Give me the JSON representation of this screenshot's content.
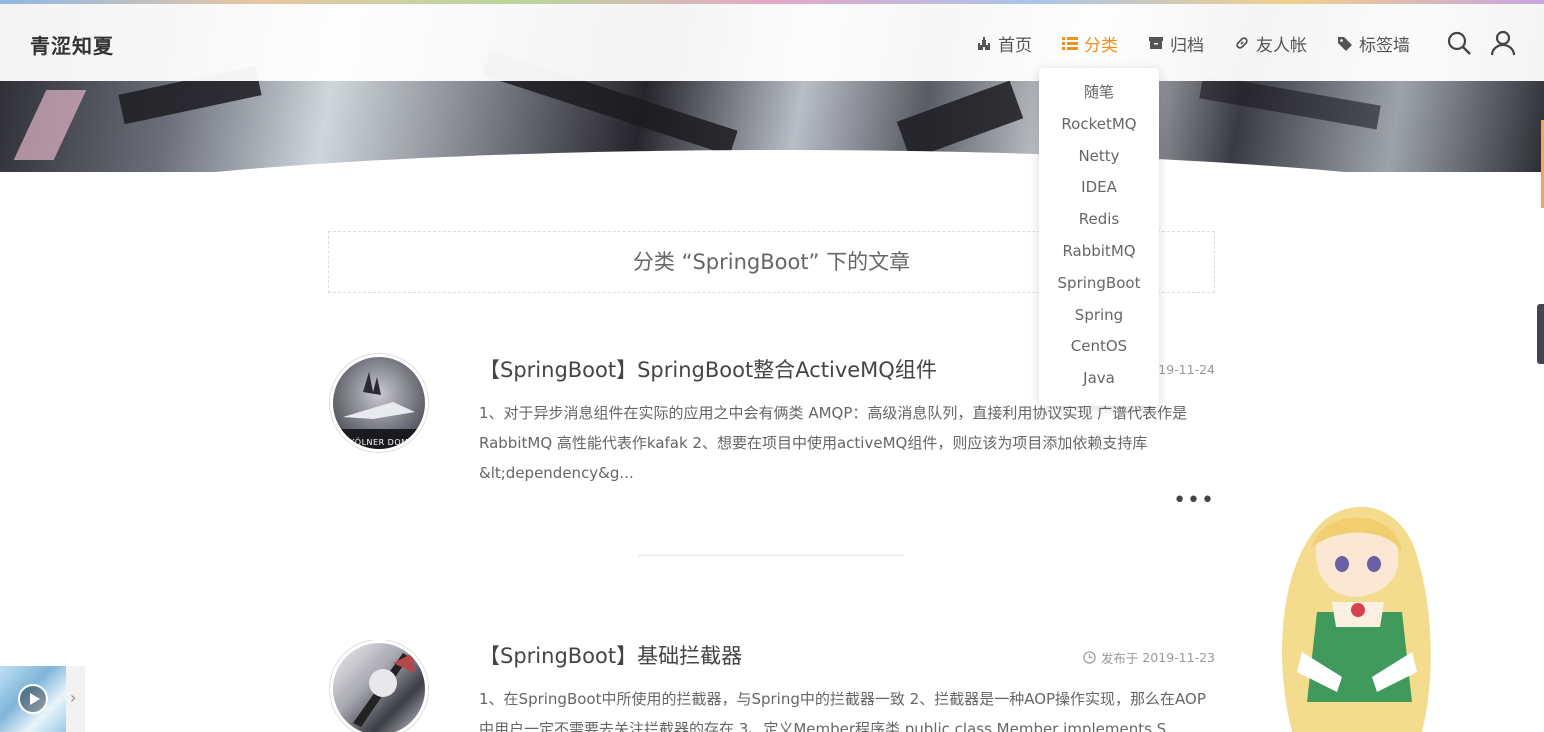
{
  "site": {
    "brand": "青涩知夏"
  },
  "nav": {
    "items": [
      {
        "label": "首页",
        "icon": "castle-icon"
      },
      {
        "label": "分类",
        "icon": "list-icon",
        "active": true
      },
      {
        "label": "归档",
        "icon": "archive-icon"
      },
      {
        "label": "友人帐",
        "icon": "link-icon"
      },
      {
        "label": "标签墙",
        "icon": "tag-icon"
      }
    ],
    "tools": [
      "search-icon",
      "user-icon"
    ]
  },
  "category_menu": {
    "items": [
      "随笔",
      "RocketMQ",
      "Netty",
      "IDEA",
      "Redis",
      "RabbitMQ",
      "SpringBoot",
      "Spring",
      "CentOS",
      "Java"
    ]
  },
  "category_header": {
    "text": "分类 “SpringBoot” 下的文章"
  },
  "posts": [
    {
      "title": "【SpringBoot】SpringBoot整合ActiveMQ组件",
      "date": "2019-11-24",
      "excerpt": "1、对于异步消息组件在实际的应用之中会有俩类 AMQP：高级消息队列，直接利用协议实现 广谱代表作是 RabbitMQ 高性能代表作kafak 2、想要在项目中使用activeMQ组件，则应该为项目添加依赖支持库 &lt;dependency&g...",
      "thumb_caption": "KÖLNER DOM",
      "more": "•••"
    },
    {
      "title": "【SpringBoot】基础拦截器",
      "date_prefix": "发布于",
      "date": "2019-11-23",
      "excerpt": "1、在SpringBoot中所使用的拦截器，与Spring中的拦截器一致 2、拦截器是一种AOP操作实现，那么在AOP 中用户一定不需要去关注拦截器的存在 3、定义Member程序类 public class Member implements S"
    }
  ],
  "colors": {
    "accent": "#f1911b",
    "text": "#555555"
  },
  "music_player": {
    "arrow": "›"
  }
}
